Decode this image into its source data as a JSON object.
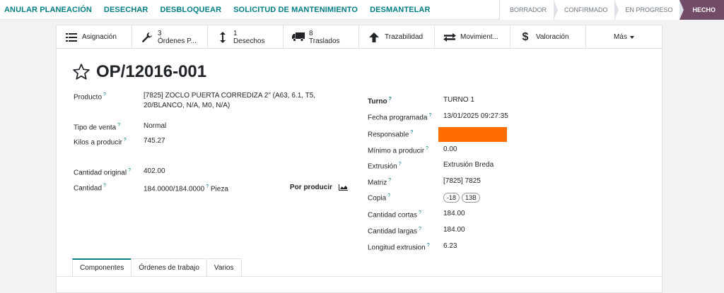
{
  "actions": [
    "ANULAR PLANEACIÓN",
    "DESECHAR",
    "DESBLOQUEAR",
    "SOLICITUD DE MANTENIMIENTO",
    "DESMANTELAR"
  ],
  "stages": [
    {
      "label": "BORRADOR",
      "active": false
    },
    {
      "label": "CONFIRMADO",
      "active": false
    },
    {
      "label": "EN PROGRESO",
      "active": false
    },
    {
      "label": "HECHO",
      "active": true
    }
  ],
  "smart_buttons": {
    "asignacion": {
      "label": "Asignación",
      "icon": "list-icon"
    },
    "ordenes": {
      "count": "3",
      "label": "Órdenes P...",
      "icon": "wrench-icon"
    },
    "desechos": {
      "count": "1",
      "label": "Desechos",
      "icon": "updown-arrow-icon"
    },
    "traslados": {
      "count": "8",
      "label": "Traslados",
      "icon": "truck-icon"
    },
    "trazabilidad": {
      "label": "Trazabilidad",
      "icon": "arrow-up-icon"
    },
    "movimientos": {
      "label": "Movimient...",
      "icon": "exchange-icon"
    },
    "valoracion": {
      "label": "Valoración",
      "icon": "dollar-icon"
    },
    "mas": {
      "label": "Más"
    }
  },
  "record": {
    "title": "OP/12016-001"
  },
  "left_fields": {
    "producto_label": "Producto",
    "producto_value_1": "[7825] ZOCLO PUERTA CORREDIZA 2\" (A63, 6.1, T5,",
    "producto_value_2": "20/BLANCO, N/A, M0, N/A)",
    "tipo_venta_label": "Tipo de venta",
    "tipo_venta_value": "Normal",
    "kilos_label": "Kilos a producir",
    "kilos_value": "745.27",
    "cant_orig_label": "Cantidad original",
    "cant_orig_value": "402.00",
    "cantidad_label": "Cantidad",
    "cantidad_value": "184.0000/184.0000",
    "cantidad_uom": "Pieza",
    "por_producir": "Por producir"
  },
  "right_fields": {
    "turno_label": "Turno",
    "turno_value": "TURNO 1",
    "fecha_label": "Fecha programada",
    "fecha_value": "13/01/2025 09:27:35",
    "responsable_label": "Responsable",
    "minimo_label": "Mínimo a producir",
    "minimo_value": "0.00",
    "extrusion_label": "Extrusión",
    "extrusion_value": "Extrusión Breda",
    "matriz_label": "Matriz",
    "matriz_value": "[7825] 7825",
    "copia_label": "Copia",
    "copia_tags": [
      "-18",
      "13B"
    ],
    "cortas_label": "Cantidad cortas",
    "cortas_value": "184.00",
    "largas_label": "Cantidad largas",
    "largas_value": "184.00",
    "longitud_label": "Longitud extrusion",
    "longitud_value": "6.23"
  },
  "tabs": [
    {
      "label": "Componentes",
      "active": true
    },
    {
      "label": "Órdenes de trabajo",
      "active": false
    },
    {
      "label": "Varios",
      "active": false
    }
  ],
  "colors": {
    "accent": "#017e84",
    "done_stage": "#714b67",
    "redaction": "#ff6d00"
  }
}
